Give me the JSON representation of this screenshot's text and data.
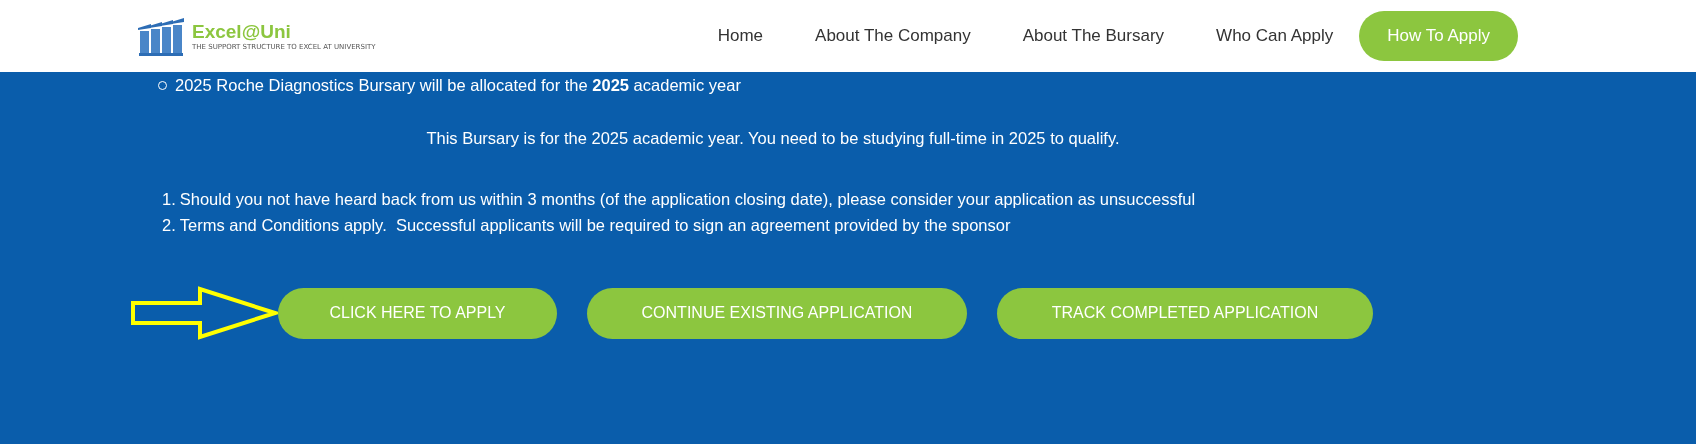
{
  "header": {
    "logo": {
      "name": "Excel@Uni",
      "tagline": "THE SUPPORT STRUCTURE TO EXCEL AT UNIVERSITY"
    },
    "nav": [
      {
        "label": "Home",
        "kind": "link"
      },
      {
        "label": "About The Company",
        "kind": "link"
      },
      {
        "label": "About The Bursary",
        "kind": "link"
      },
      {
        "label": "Who Can Apply",
        "kind": "link"
      },
      {
        "label": "How To Apply",
        "kind": "button"
      }
    ]
  },
  "content": {
    "bullet": "2025 Roche Diagnostics Bursary will be allocated for the **2025** academic year",
    "notice": "This Bursary is for the 2025 academic year. You need to be studying full-time in 2025 to qualify.",
    "numbered": [
      {
        "number": "1.",
        "text": "Should you not have heard back from us within 3 months (of the application closing date), please consider your application as unsuccessful"
      },
      {
        "number": "2.",
        "text": "Terms and Conditions apply.  Successful applicants will be required to sign an agreement provided by the sponsor"
      }
    ],
    "buttons": [
      "CLICK HERE TO APPLY",
      "CONTINUE EXISTING APPLICATION",
      "TRACK COMPLETED APPLICATION"
    ]
  }
}
